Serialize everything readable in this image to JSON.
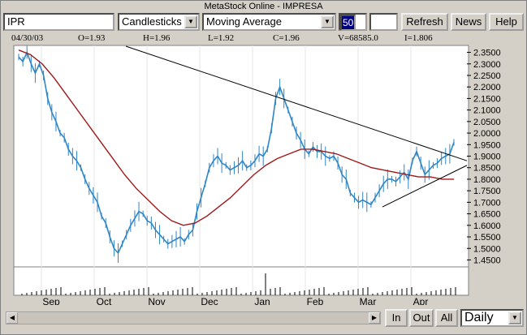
{
  "window": {
    "title": "MetaStock Online - IMPRESA"
  },
  "toolbar": {
    "symbol_value": "IPR",
    "chart_style_value": "Candlesticks",
    "indicator_value": "Moving Average",
    "period_value": "50",
    "extra_value": "",
    "refresh_label": "Refresh",
    "news_label": "News",
    "help_label": "Help"
  },
  "info": {
    "date": "04/30/03",
    "open": "O=1.93",
    "high": "H=1.96",
    "low": "L=1.92",
    "close": "C=1.96",
    "volume": "V=68585.0",
    "indicator": "I=1.806"
  },
  "bottom": {
    "in_label": "In",
    "out_label": "Out",
    "all_label": "All",
    "interval_value": "Daily"
  },
  "colors": {
    "price": "#2f86c6",
    "ma": "#a01818",
    "trend": "#000000",
    "bg": "#ffffff",
    "frame": "#d4d0c8"
  },
  "icons": {
    "dropdown": "chevron-down-icon",
    "scroll_left": "arrow-left-icon",
    "scroll_right": "arrow-right-icon"
  },
  "chart_data": {
    "type": "line",
    "y_ticks": [
      "2.3500",
      "2.3000",
      "2.2500",
      "2.2000",
      "2.1500",
      "2.1000",
      "2.0500",
      "2.0000",
      "1.9500",
      "1.9000",
      "1.8500",
      "1.8000",
      "1.7500",
      "1.7000",
      "1.6500",
      "1.6000",
      "1.5500",
      "1.5000",
      "1.4500"
    ],
    "ylim": [
      1.42,
      2.38
    ],
    "x_labels": [
      "Sep",
      "Oct",
      "Nov",
      "Dec",
      "Jan",
      "Feb",
      "Mar",
      "Apr"
    ],
    "series": [
      {
        "values": [
          2.33,
          2.31,
          2.35,
          2.3,
          2.26,
          2.3,
          2.25,
          2.15,
          2.09,
          2.05,
          2.0,
          1.98,
          1.93,
          1.9,
          1.88,
          1.85,
          1.8,
          1.76,
          1.73,
          1.7,
          1.64,
          1.61,
          1.55,
          1.5,
          1.48,
          1.52,
          1.56,
          1.6,
          1.63,
          1.66,
          1.65,
          1.62,
          1.61,
          1.58,
          1.56,
          1.54,
          1.52,
          1.53,
          1.54,
          1.55,
          1.53,
          1.56,
          1.58,
          1.66,
          1.72,
          1.78,
          1.85,
          1.88,
          1.9,
          1.87,
          1.86,
          1.84,
          1.85,
          1.86,
          1.88,
          1.85,
          1.86,
          1.88,
          1.91,
          1.9,
          1.93,
          2.02,
          2.15,
          2.2,
          2.15,
          2.1,
          2.05,
          2.0,
          1.97,
          1.93,
          1.91,
          1.94,
          1.92,
          1.92,
          1.9,
          1.89,
          1.9,
          1.87,
          1.82,
          1.8,
          1.74,
          1.72,
          1.7,
          1.71,
          1.7,
          1.69,
          1.72,
          1.75,
          1.78,
          1.8,
          1.8,
          1.79,
          1.81,
          1.83,
          1.8,
          1.88,
          1.92,
          1.87,
          1.82,
          1.84,
          1.86,
          1.87,
          1.89,
          1.9,
          1.91,
          1.96
        ]
      },
      {
        "values": [
          2.36,
          2.34,
          2.3,
          2.24,
          2.17,
          2.1,
          2.03,
          1.96,
          1.89,
          1.82,
          1.76,
          1.71,
          1.66,
          1.62,
          1.6,
          1.61,
          1.64,
          1.68,
          1.72,
          1.77,
          1.82,
          1.86,
          1.89,
          1.91,
          1.93,
          1.93,
          1.92,
          1.91,
          1.89,
          1.87,
          1.85,
          1.84,
          1.83,
          1.82,
          1.81,
          1.81,
          1.8,
          1.8
        ]
      }
    ]
  }
}
